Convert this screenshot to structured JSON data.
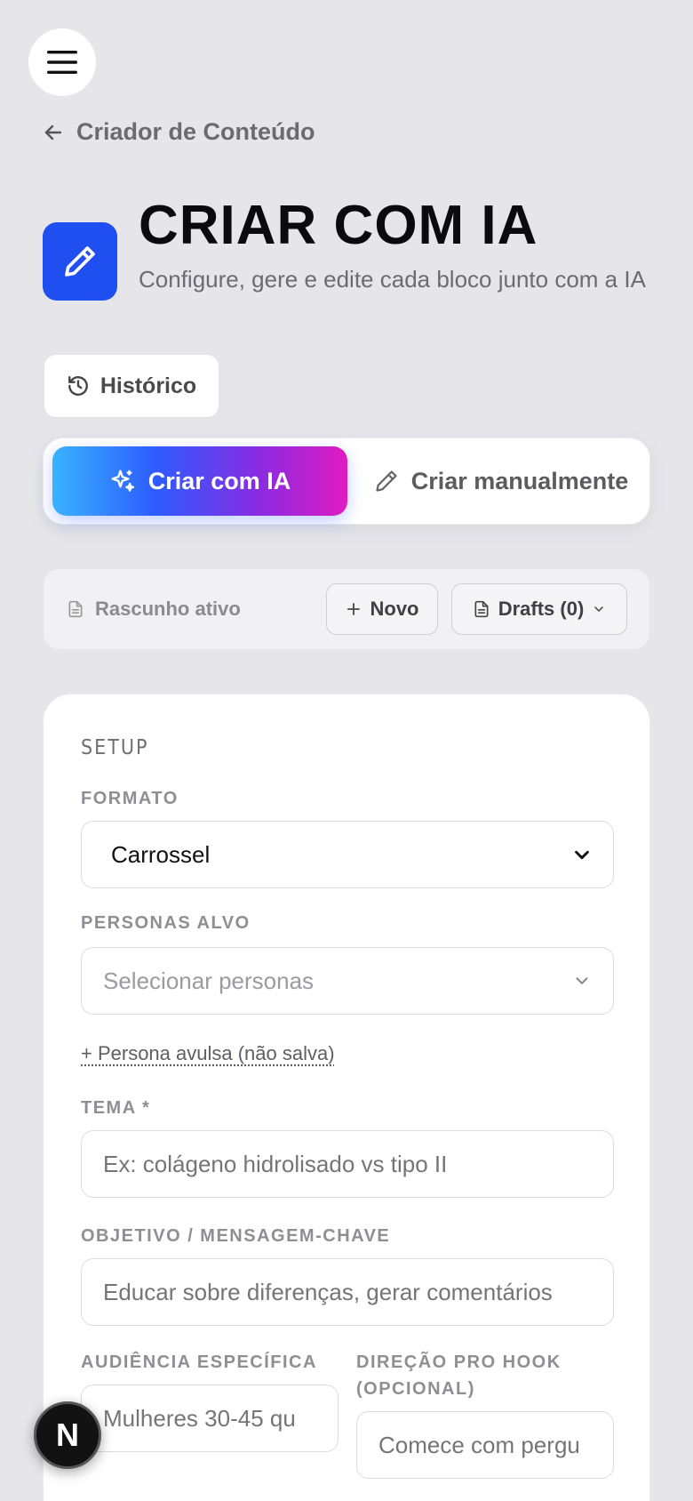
{
  "topbar": {
    "menu_icon": "hamburger-icon"
  },
  "breadcrumb": {
    "back_label": "Criador de Conteúdo"
  },
  "header": {
    "title": "CRIAR COM IA",
    "subtitle": "Configure, gere e edite cada bloco junto com a IA",
    "icon": "pencil-icon",
    "accent_color": "#1f4ff0"
  },
  "history_button": {
    "label": "Histórico",
    "icon": "history-icon"
  },
  "mode_toggle": {
    "ai_label": "Criar com IA",
    "manual_label": "Criar manualmente",
    "active": "ai"
  },
  "draft_bar": {
    "status_label": "Rascunho ativo",
    "new_label": "Novo",
    "drafts_label": "Drafts (0)"
  },
  "setup": {
    "section_title": "SETUP",
    "format": {
      "label": "FORMATO",
      "value": "Carrossel"
    },
    "personas": {
      "label": "PERSONAS ALVO",
      "placeholder": "Selecionar personas",
      "link": "+ Persona avulsa (não salva)"
    },
    "theme": {
      "label": "TEMA *",
      "placeholder": "Ex: colágeno hidrolisado vs tipo II"
    },
    "objective": {
      "label": "OBJETIVO / MENSAGEM-CHAVE",
      "placeholder": "Educar sobre diferenças, gerar comentários"
    },
    "audience": {
      "label": "AUDIÊNCIA ESPECÍFICA",
      "placeholder": "Mulheres 30-45 qu"
    },
    "hook": {
      "label_line1": "DIREÇÃO PRO HOOK",
      "label_line2": "(OPCIONAL)",
      "placeholder": "Comece com pergu"
    }
  },
  "dev_badge": {
    "label": "N"
  }
}
